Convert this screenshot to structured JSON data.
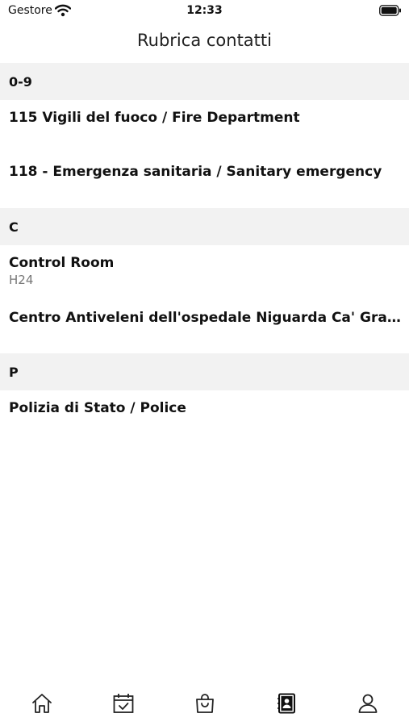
{
  "status_bar": {
    "carrier": "Gestore",
    "time": "12:33"
  },
  "header": {
    "title": "Rubrica contatti"
  },
  "sections": [
    {
      "header": "0-9",
      "rows": [
        {
          "title": "115 Vigili del fuoco / Fire Department"
        },
        {
          "title": "118 - Emergenza sanitaria / Sanitary emergency"
        }
      ]
    },
    {
      "header": "C",
      "rows": [
        {
          "title": "Control Room",
          "subtitle": "H24"
        },
        {
          "title": "Centro Antiveleni dell'ospedale Niguarda Ca' Granda"
        }
      ]
    },
    {
      "header": "P",
      "rows": [
        {
          "title": "Polizia di Stato / Police"
        }
      ]
    }
  ],
  "tab_bar": {
    "tabs": [
      {
        "icon": "home-icon"
      },
      {
        "icon": "calendar-check-icon"
      },
      {
        "icon": "shopping-bag-icon"
      },
      {
        "icon": "contacts-book-icon",
        "active": true
      },
      {
        "icon": "user-icon"
      }
    ]
  }
}
